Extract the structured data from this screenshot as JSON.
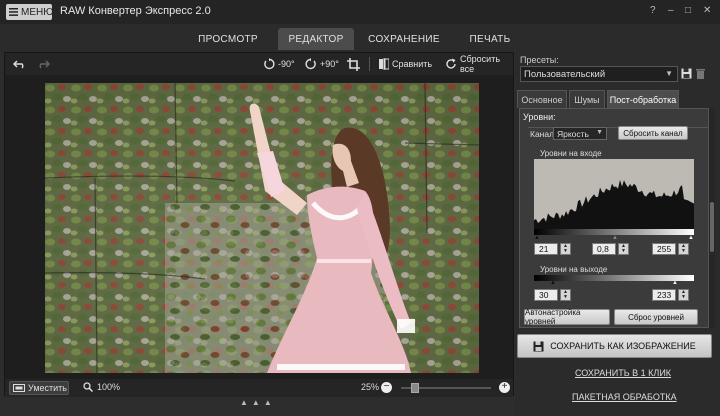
{
  "app": {
    "menu_label": "МЕНЮ",
    "title": "RAW Конвертер Экспресс 2.0",
    "win_controls": [
      "?",
      "–",
      "□",
      "✕"
    ]
  },
  "tabs": [
    {
      "label": "ПРОСМОТР",
      "active": false
    },
    {
      "label": "РЕДАКТОР",
      "active": true
    },
    {
      "label": "СОХРАНЕНИЕ",
      "active": false
    },
    {
      "label": "ПЕЧАТЬ",
      "active": false
    }
  ],
  "toolbar": {
    "undo_icon": "undo-icon",
    "redo_icon": "redo-icon",
    "rotate_left_label": "-90°",
    "rotate_right_label": "+90°",
    "crop_icon": "crop-icon",
    "compare_label": "Сравнить",
    "reset_all_label": "Сбросить все"
  },
  "bottombar": {
    "fit_label": "Уместить",
    "actual_zoom_label": "100%",
    "zoom_percent": "25%",
    "zoom_slider_fraction": 0.12
  },
  "right": {
    "presets_label": "Пресеты:",
    "preset_value": "Пользовательский",
    "subtabs": [
      {
        "label": "Основное",
        "active": false
      },
      {
        "label": "Шумы",
        "active": false
      },
      {
        "label": "Пост-обработка",
        "active": true
      }
    ],
    "levels": {
      "title": "Уровни:",
      "channel_label": "Канал",
      "channel_value": "Яркость",
      "reset_channel_label": "Сбросить канал",
      "input_levels_label": "Уровни на входе",
      "input_black": "21",
      "input_gamma": "0,8",
      "input_white": "255",
      "output_levels_label": "Уровни на выходе",
      "output_black": "30",
      "output_white": "233",
      "auto_levels_label": "Автонастройка уровней",
      "reset_levels_label": "Сброс уровней"
    },
    "save_as_image_label": "СОХРАНИТЬ КАК ИЗОБРАЖЕНИЕ",
    "save_one_click_label": "СОХРАНИТЬ В 1 КЛИК",
    "batch_label": "ПАКЕТНАЯ ОБРАБОТКА"
  },
  "colors": {
    "accent_tab": "#4c4c4c",
    "dress_pink": "#e9b9c0"
  }
}
